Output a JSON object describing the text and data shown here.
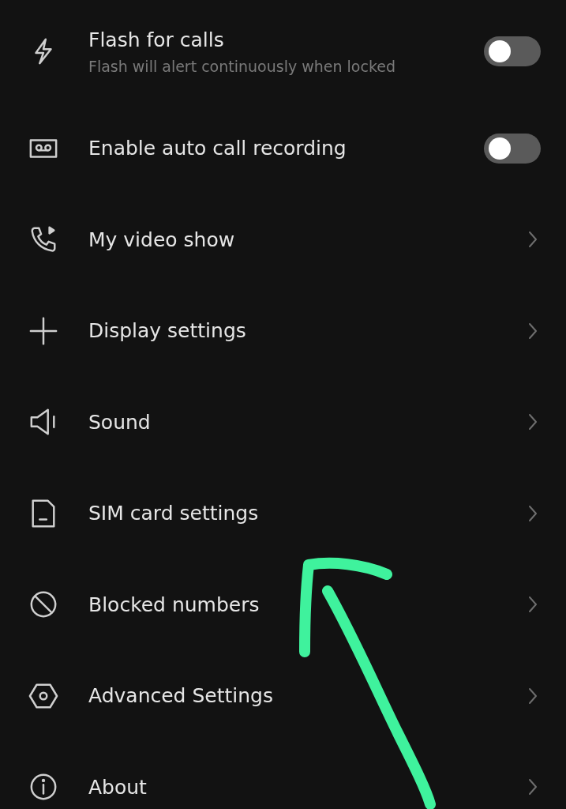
{
  "settings": [
    {
      "kind": "toggle",
      "title": "Flash for calls",
      "subtitle": "Flash will alert continuously when locked",
      "on": false
    },
    {
      "kind": "toggle",
      "title": "Enable auto call recording",
      "on": false
    },
    {
      "kind": "link",
      "title": "My video show"
    },
    {
      "kind": "link",
      "title": "Display settings"
    },
    {
      "kind": "link",
      "title": "Sound"
    },
    {
      "kind": "link",
      "title": "SIM card settings"
    },
    {
      "kind": "link",
      "title": "Blocked numbers"
    },
    {
      "kind": "link",
      "title": "Advanced Settings"
    },
    {
      "kind": "link",
      "title": "About"
    }
  ],
  "annotation": {
    "kind": "arrow"
  }
}
